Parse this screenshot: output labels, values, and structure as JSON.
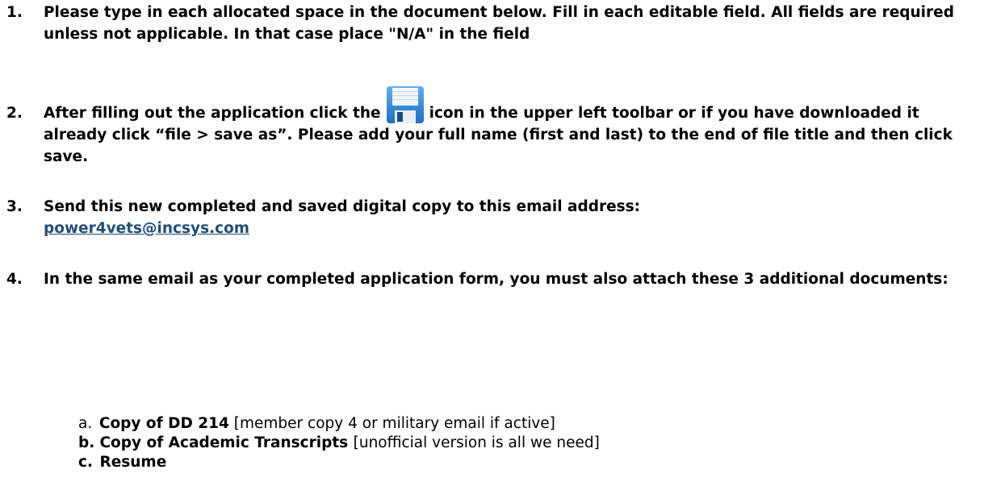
{
  "instructions": {
    "step1": {
      "number": "1.",
      "text": "Please type in each allocated space in the document below. Fill in each editable field.  All fields are required unless not applicable. In that case place \"N/A\" in the field"
    },
    "step2": {
      "number": "2.",
      "text_before_icon": "After filling out the application click the",
      "icon": "save-icon",
      "text_after_icon": "icon in the upper left toolbar or if you have downloaded it already click “file > save as”.  Please add your full name (first and last) to the end of file title and then click save."
    },
    "step3": {
      "number": "3.",
      "text": "Send this new completed and saved digital copy to this email address:",
      "email": "power4vets@incsys.com"
    },
    "step4": {
      "number": "4.",
      "text": "In the same email as your completed application form, you must also attach these 3 additional documents:",
      "items": [
        {
          "letter": "a.",
          "title": "Copy of DD 214",
          "note": "[member copy 4 or military email if active]"
        },
        {
          "letter": "b.",
          "title": "Copy of Academic Transcripts",
          "note": "[unofficial version is all we need]"
        },
        {
          "letter": "c.",
          "title": "Resume",
          "note": ""
        }
      ]
    }
  },
  "colors": {
    "link": "#1f4e79",
    "icon_blue": "#2a7fd4"
  }
}
